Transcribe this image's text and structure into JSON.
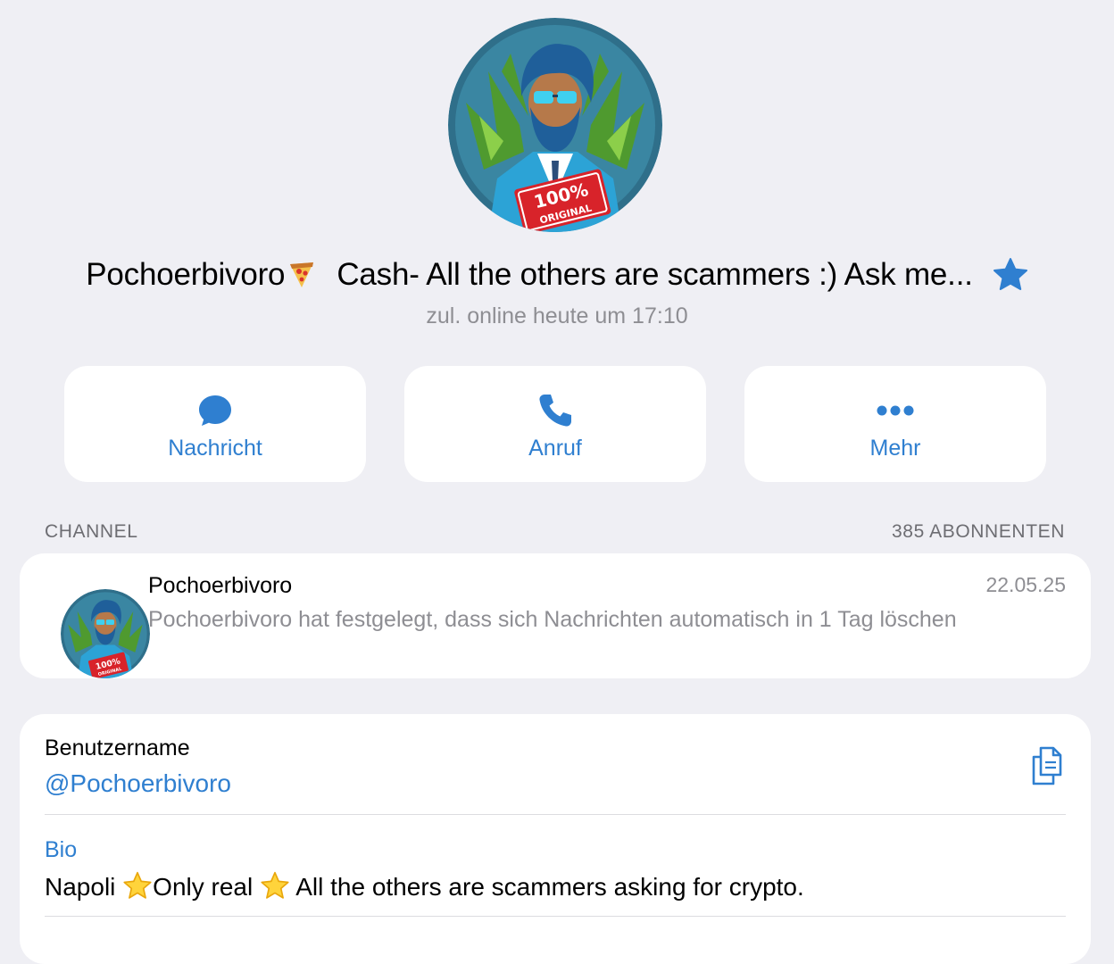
{
  "profile": {
    "name": "Pochoerbivoro",
    "name_rest": "Cash- All the others are scammers :) Ask me...",
    "last_seen": "zul. online heute um 17:10",
    "avatar_badge_line1": "100%",
    "avatar_badge_line2": "ORIGINAL",
    "verified_icon": "star-badge-icon"
  },
  "actions": [
    {
      "label": "Nachricht",
      "icon": "message-bubble-icon"
    },
    {
      "label": "Anruf",
      "icon": "phone-icon"
    },
    {
      "label": "Mehr",
      "icon": "more-dots-icon"
    }
  ],
  "channel_section": {
    "header_left": "CHANNEL",
    "header_right": "385 ABONNENTEN",
    "item": {
      "name": "Pochoerbivoro",
      "date": "22.05.25",
      "preview": "Pochoerbivoro hat festgelegt, dass sich Nachrichten automatisch in 1 Tag löschen"
    }
  },
  "info": {
    "username_label": "Benutzername",
    "username_value": "@Pochoerbivoro",
    "bio_label": "Bio",
    "bio_part1": "Napoli",
    "bio_part2": "Only real",
    "bio_part3": "All the others are scammers asking for crypto."
  },
  "colors": {
    "accent": "#2f7fd0",
    "background": "#efeff4",
    "secondary_text": "#8e8e93"
  }
}
